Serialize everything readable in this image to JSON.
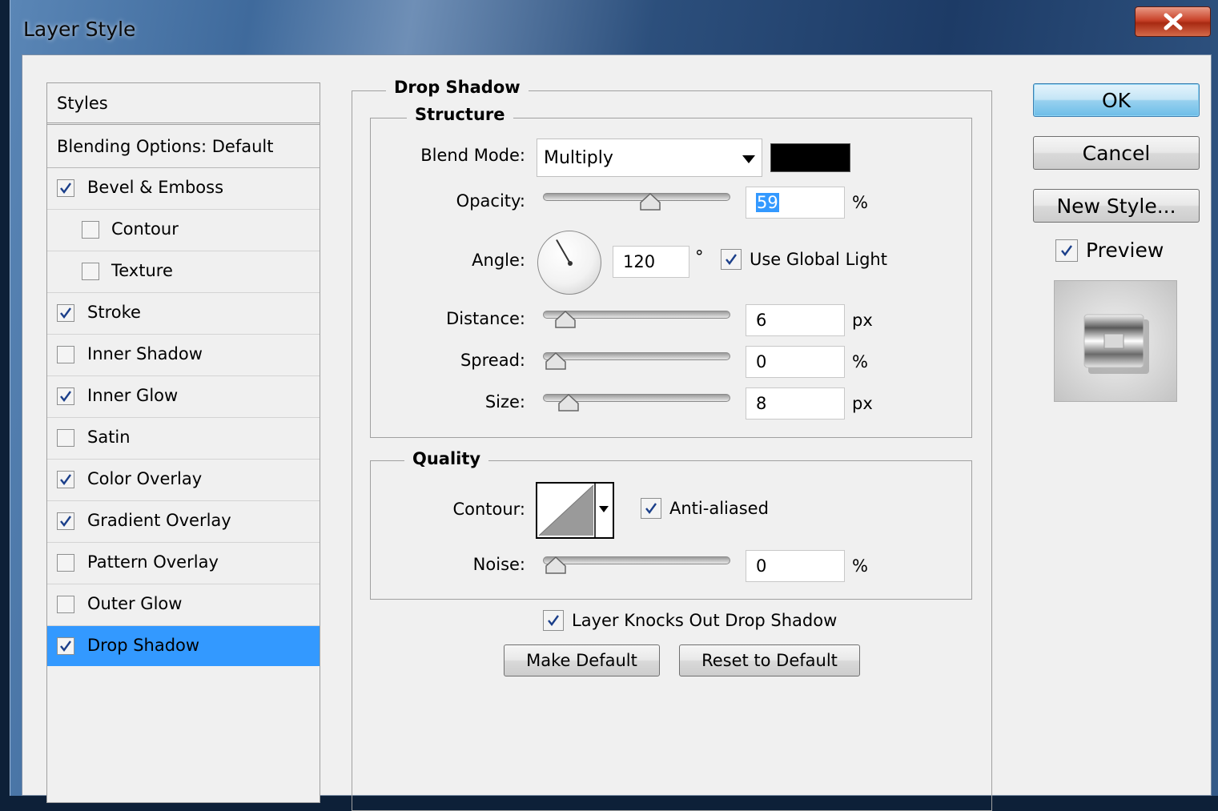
{
  "window": {
    "title": "Layer Style"
  },
  "styles_panel": {
    "header": "Styles",
    "blending_options": "Blending Options: Default",
    "items": [
      {
        "label": "Bevel & Emboss",
        "checked": true,
        "indent": false,
        "selected": false
      },
      {
        "label": "Contour",
        "checked": false,
        "indent": true,
        "selected": false
      },
      {
        "label": "Texture",
        "checked": false,
        "indent": true,
        "selected": false
      },
      {
        "label": "Stroke",
        "checked": true,
        "indent": false,
        "selected": false
      },
      {
        "label": "Inner Shadow",
        "checked": false,
        "indent": false,
        "selected": false
      },
      {
        "label": "Inner Glow",
        "checked": true,
        "indent": false,
        "selected": false
      },
      {
        "label": "Satin",
        "checked": false,
        "indent": false,
        "selected": false
      },
      {
        "label": "Color Overlay",
        "checked": true,
        "indent": false,
        "selected": false
      },
      {
        "label": "Gradient Overlay",
        "checked": true,
        "indent": false,
        "selected": false
      },
      {
        "label": "Pattern Overlay",
        "checked": false,
        "indent": false,
        "selected": false
      },
      {
        "label": "Outer Glow",
        "checked": false,
        "indent": false,
        "selected": false
      },
      {
        "label": "Drop Shadow",
        "checked": true,
        "indent": false,
        "selected": true
      }
    ]
  },
  "drop_shadow": {
    "title": "Drop Shadow",
    "structure": {
      "title": "Structure",
      "blend_mode_label": "Blend Mode:",
      "blend_mode_value": "Multiply",
      "shadow_color": "#000000",
      "opacity_label": "Opacity:",
      "opacity_value": "59",
      "opacity_unit": "%",
      "opacity_fraction": 0.59,
      "angle_label": "Angle:",
      "angle_value": "120",
      "angle_unit": "°",
      "use_global_light_label": "Use Global Light",
      "use_global_light": true,
      "distance_label": "Distance:",
      "distance_value": "6",
      "distance_unit": "px",
      "distance_fraction": 0.06,
      "spread_label": "Spread:",
      "spread_value": "0",
      "spread_unit": "%",
      "spread_fraction": 0.0,
      "size_label": "Size:",
      "size_value": "8",
      "size_unit": "px",
      "size_fraction": 0.08
    },
    "quality": {
      "title": "Quality",
      "contour_label": "Contour:",
      "anti_aliased_label": "Anti-aliased",
      "anti_aliased": true,
      "noise_label": "Noise:",
      "noise_value": "0",
      "noise_unit": "%",
      "noise_fraction": 0.0
    },
    "knockout_label": "Layer Knocks Out Drop Shadow",
    "knockout": true,
    "make_default_label": "Make Default",
    "reset_default_label": "Reset to Default"
  },
  "buttons": {
    "ok": "OK",
    "cancel": "Cancel",
    "new_style": "New Style...",
    "preview_label": "Preview",
    "preview_checked": true
  },
  "colors": {
    "selection": "#3399ff",
    "ok_button": "#98d1ef"
  }
}
